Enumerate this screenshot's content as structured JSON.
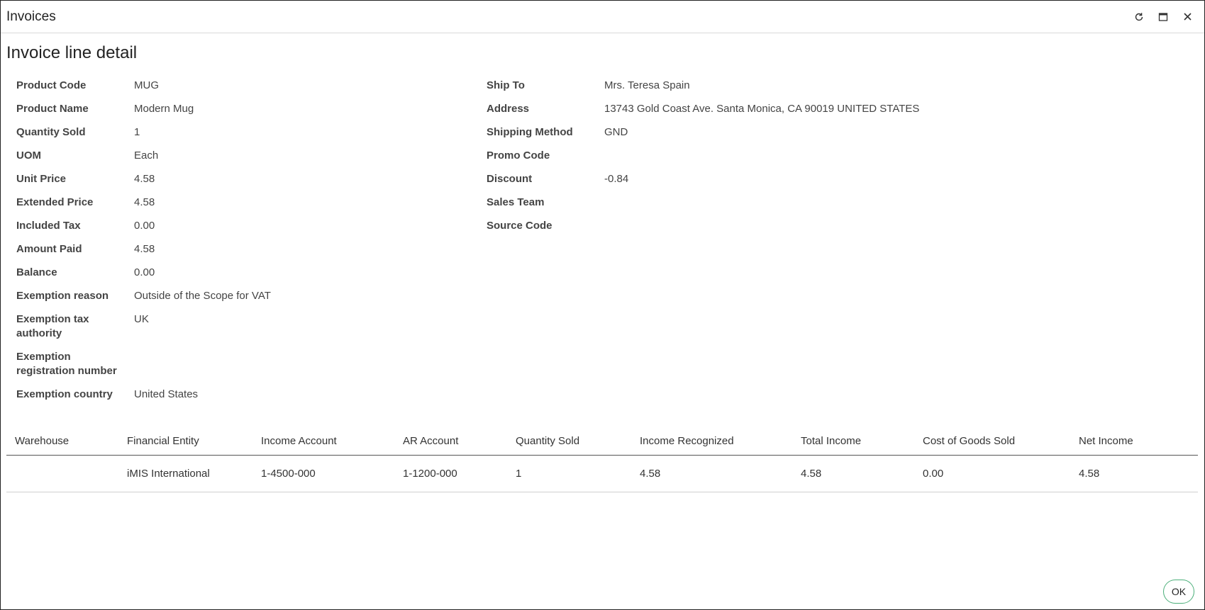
{
  "window": {
    "title": "Invoices"
  },
  "page": {
    "title": "Invoice line detail"
  },
  "left_fields": [
    {
      "label": "Product Code",
      "value": "MUG"
    },
    {
      "label": "Product Name",
      "value": "Modern Mug"
    },
    {
      "label": "Quantity Sold",
      "value": "1"
    },
    {
      "label": "UOM",
      "value": "Each"
    },
    {
      "label": "Unit Price",
      "value": "4.58"
    },
    {
      "label": "Extended Price",
      "value": "4.58"
    },
    {
      "label": "Included Tax",
      "value": "0.00"
    },
    {
      "label": "Amount Paid",
      "value": "4.58"
    },
    {
      "label": "Balance",
      "value": "0.00"
    },
    {
      "label": "Exemption reason",
      "value": "Outside of the Scope for VAT"
    },
    {
      "label": "Exemption tax authority",
      "value": "UK"
    },
    {
      "label": "Exemption registration number",
      "value": ""
    },
    {
      "label": "Exemption country",
      "value": "United States"
    }
  ],
  "right_fields": [
    {
      "label": "Ship To",
      "value": "Mrs. Teresa Spain"
    },
    {
      "label": "Address",
      "value": "13743 Gold Coast Ave. Santa Monica, CA 90019 UNITED STATES"
    },
    {
      "label": "Shipping Method",
      "value": "GND"
    },
    {
      "label": "Promo Code",
      "value": ""
    },
    {
      "label": "Discount",
      "value": "-0.84"
    },
    {
      "label": "Sales Team",
      "value": ""
    },
    {
      "label": "Source Code",
      "value": ""
    }
  ],
  "table": {
    "columns": [
      "Warehouse",
      "Financial Entity",
      "Income Account",
      "AR Account",
      "Quantity Sold",
      "Income Recognized",
      "Total Income",
      "Cost of Goods Sold",
      "Net Income"
    ],
    "rows": [
      [
        "",
        "iMIS International",
        "1-4500-000",
        "1-1200-000",
        "1",
        "4.58",
        "4.58",
        "0.00",
        "4.58"
      ]
    ]
  },
  "footer": {
    "ok_label": "OK"
  },
  "icons": {
    "refresh": "refresh-icon",
    "maximize": "maximize-icon",
    "close": "close-icon"
  },
  "colors": {
    "ok_border": "#4caf7a"
  }
}
